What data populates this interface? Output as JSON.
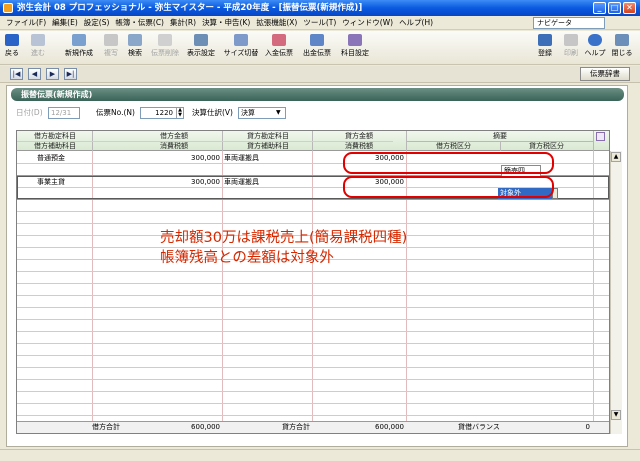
{
  "window": {
    "title": "弥生会計 08 プロフェッショナル - 弥生マイスター - 平成20年度 - [振替伝票(新規作成)]"
  },
  "menus": [
    "ファイル(F)",
    "編集(E)",
    "設定(S)",
    "帳簿・伝票(C)",
    "集計(R)",
    "決算・申告(K)",
    "拡張機能(X)",
    "ツール(T)",
    "ウィンドウ(W)",
    "ヘルプ(H)"
  ],
  "navi": {
    "label": "ナビゲータ"
  },
  "toolbar": {
    "back": "戻る",
    "forward": "進む",
    "new": "新規作成",
    "copy": "複写",
    "search": "検索",
    "delete": "伝票削除",
    "display": "表示設定",
    "resize": "サイズ切替",
    "receipt": "入金伝票",
    "payment": "出金伝票",
    "account": "科目設定",
    "register": "登録",
    "print": "印刷",
    "help": "ヘルプ",
    "close": "閉じる"
  },
  "recnav": {
    "first": "|◀",
    "prev": "◀",
    "next": "▶",
    "last": "▶|",
    "dict_button": "伝票辞書"
  },
  "panel": {
    "title": "振替伝票(新規作成)"
  },
  "form": {
    "date_label": "日付(D)",
    "date_value": "12/31",
    "slip_no_label": "伝票No.(N)",
    "slip_no_value": "1220",
    "kessan_label": "決算仕訳(V)",
    "kessan_value": "決算"
  },
  "columns": {
    "debit_account": "借方勘定科目",
    "debit_sub": "借方補助科目",
    "debit_amount": "借方金額",
    "debit_tax": "消費税額",
    "credit_account": "貸方勘定科目",
    "credit_sub": "貸方補助科目",
    "credit_amount": "貸方金額",
    "credit_tax": "消費税額",
    "summary": "摘要",
    "debit_tax_cat": "借方税区分",
    "credit_tax_cat": "貸方税区分"
  },
  "rows": [
    {
      "debit_account": "普通預金",
      "debit_amount": "300,000",
      "credit_account": "車両運搬具",
      "credit_amount": "300,000",
      "credit_tax_cat": "簡売四"
    },
    {
      "debit_account": "事業主貸",
      "debit_amount": "300,000",
      "credit_account": "車両運搬具",
      "credit_amount": "300,000",
      "credit_tax_cat": "対象外"
    }
  ],
  "footer": {
    "debit_total_label": "借方合計",
    "debit_total": "600,000",
    "credit_total_label": "貸方合計",
    "credit_total": "600,000",
    "balance_label": "貸借バランス",
    "balance": "0"
  },
  "annotation": {
    "line1": "売却額30万は課税売上(簡易課税四種)",
    "line2": "帳簿残高との差額は対象外"
  }
}
